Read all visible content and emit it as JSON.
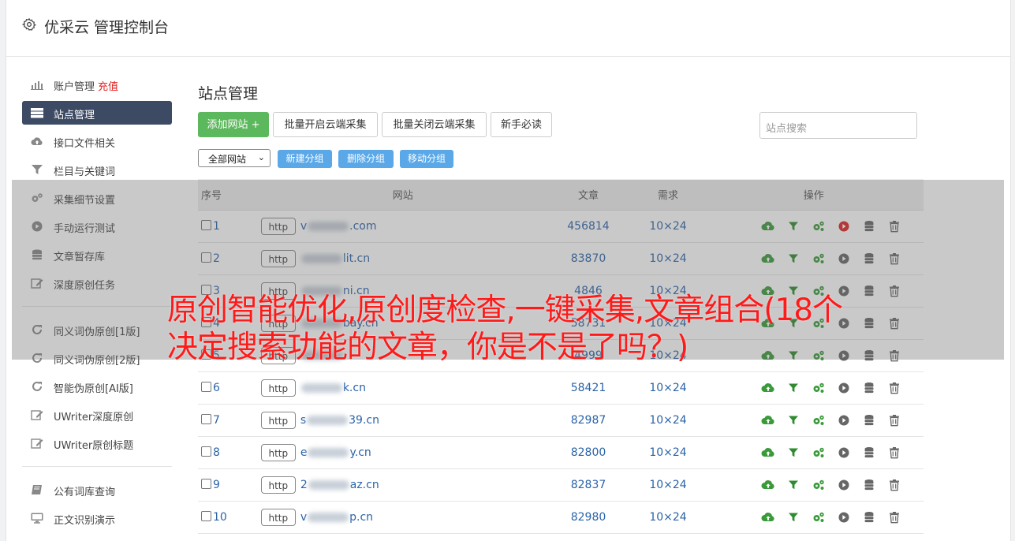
{
  "header": {
    "title": "优采云 管理控制台"
  },
  "sidebar": {
    "groups": [
      [
        {
          "label": "账户管理",
          "tag": "充值",
          "icon": "bar-chart-icon"
        },
        {
          "label": "站点管理",
          "icon": "server-icon",
          "active": true
        },
        {
          "label": "接口文件相关",
          "icon": "cloud-upload-icon"
        },
        {
          "label": "栏目与关键词",
          "icon": "filter-icon"
        },
        {
          "label": "采集细节设置",
          "icon": "cogs-icon"
        },
        {
          "label": "手动运行测试",
          "icon": "play-icon"
        },
        {
          "label": "文章暂存库",
          "icon": "database-icon"
        },
        {
          "label": "深度原创任务",
          "icon": "edit-icon"
        }
      ],
      [
        {
          "label": "同义词伪原创[1版]",
          "icon": "refresh-icon"
        },
        {
          "label": "同义词伪原创[2版]",
          "icon": "refresh-icon"
        },
        {
          "label": "智能伪原创[AI版]",
          "icon": "refresh-icon"
        },
        {
          "label": "UWriter深度原创",
          "icon": "edit-icon"
        },
        {
          "label": "UWriter原创标题",
          "icon": "edit-icon"
        }
      ],
      [
        {
          "label": "公有词库查询",
          "icon": "book-icon"
        },
        {
          "label": "正文识别演示",
          "icon": "monitor-icon"
        }
      ]
    ]
  },
  "main": {
    "title": "站点管理",
    "buttons": {
      "add": "添加网站 +",
      "batch_open": "批量开启云端采集",
      "batch_close": "批量关闭云端采集",
      "newbie": "新手必读"
    },
    "search_placeholder": "站点搜索",
    "group_select": "全部网站",
    "group_buttons": {
      "new": "新建分组",
      "delete": "删除分组",
      "move": "移动分组"
    },
    "table": {
      "headers": {
        "no": "序号",
        "site": "网站",
        "articles": "文章",
        "demand": "需求",
        "ops": "操作"
      },
      "rows": [
        {
          "no": "1",
          "http": "http",
          "pre": "v",
          "post": ".com",
          "articles": "456814",
          "demand": "10×24",
          "active": true
        },
        {
          "no": "2",
          "http": "http",
          "pre": "",
          "post": "lit.cn",
          "articles": "83870",
          "demand": "10×24",
          "active": false
        },
        {
          "no": "3",
          "http": "http",
          "pre": "",
          "post": "ni.cn",
          "articles": "4846",
          "demand": "10×24",
          "active": false
        },
        {
          "no": "4",
          "http": "http",
          "pre": "",
          "post": "bay.cn",
          "articles": "58731",
          "demand": "10×24",
          "active": false
        },
        {
          "no": "5",
          "http": "http",
          "pre": "",
          "post": "",
          "articles": "4999",
          "demand": "10×24",
          "active": false
        },
        {
          "no": "6",
          "http": "http",
          "pre": "",
          "post": "k.cn",
          "articles": "58421",
          "demand": "10×24",
          "active": false
        },
        {
          "no": "7",
          "http": "http",
          "pre": "s",
          "post": "39.cn",
          "articles": "82987",
          "demand": "10×24",
          "active": false
        },
        {
          "no": "8",
          "http": "http",
          "pre": "e",
          "post": "y.cn",
          "articles": "82800",
          "demand": "10×24",
          "active": false
        },
        {
          "no": "9",
          "http": "http",
          "pre": "2",
          "post": "az.cn",
          "articles": "82837",
          "demand": "10×24",
          "active": false
        },
        {
          "no": "10",
          "http": "http",
          "pre": "v",
          "post": "p.cn",
          "articles": "82980",
          "demand": "10×24",
          "active": false
        }
      ]
    }
  },
  "overlay": {
    "headline": "原创智能优化,原创度检查,一键采集,文章组合(18个决定搜索功能的文章，你是不是了吗？)"
  },
  "colors": {
    "active_nav": "#3c4a63",
    "add_button": "#5cb85c",
    "group_button": "#5aa8e8",
    "link": "#2a63a8",
    "headline": "#ff1a1a"
  }
}
